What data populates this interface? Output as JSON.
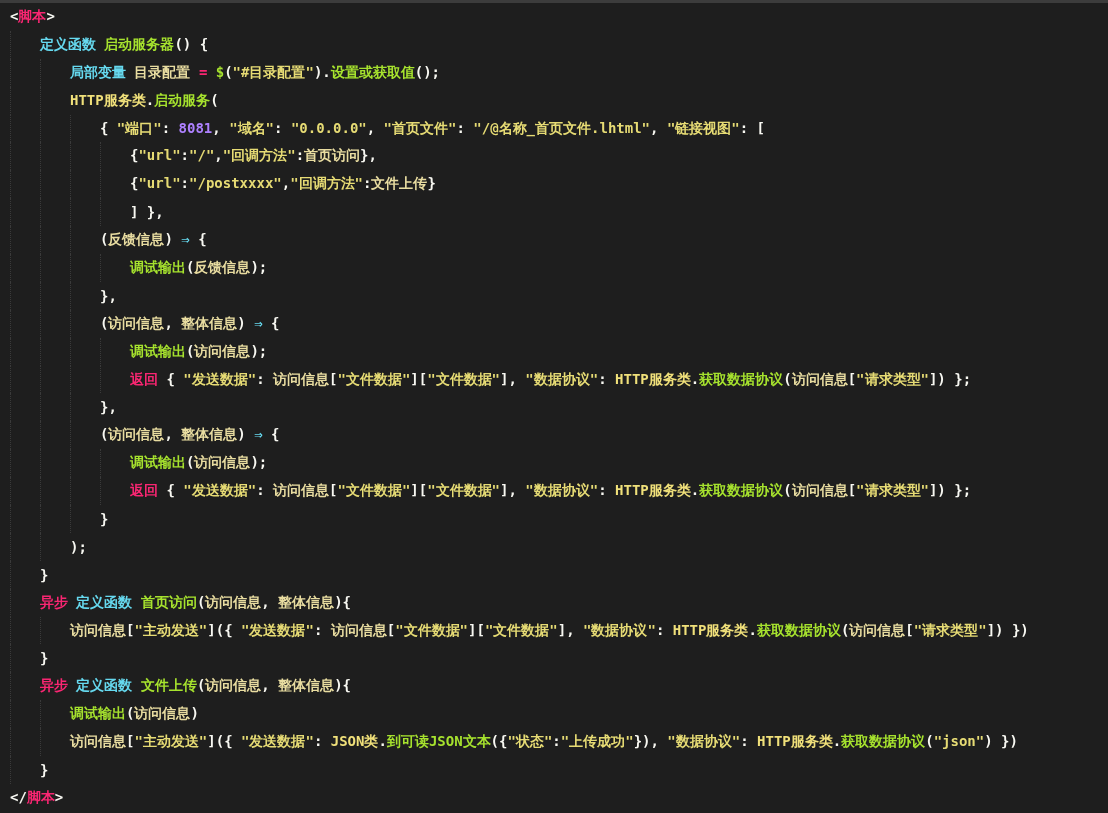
{
  "editor": {
    "lines": [
      {
        "tokens": [
          {
            "kind": "punct",
            "text": "<"
          },
          {
            "kind": "tag",
            "text": "脚本"
          },
          {
            "kind": "punct",
            "text": ">"
          }
        ],
        "children": [
          {
            "tokens": [
              {
                "kind": "kw",
                "text": "定义函数 "
              },
              {
                "kind": "fn",
                "text": "启动服务器"
              },
              {
                "kind": "punct",
                "text": "() {"
              }
            ],
            "children": [
              {
                "tokens": [
                  {
                    "kind": "kw",
                    "text": "局部变量 "
                  },
                  {
                    "kind": "id",
                    "text": "目录配置 "
                  },
                  {
                    "kind": "op",
                    "text": "= "
                  },
                  {
                    "kind": "fn",
                    "text": "$"
                  },
                  {
                    "kind": "punct",
                    "text": "("
                  },
                  {
                    "kind": "str",
                    "text": "\"#目录配置\""
                  },
                  {
                    "kind": "punct",
                    "text": ")."
                  },
                  {
                    "kind": "fn",
                    "text": "设置或获取值"
                  },
                  {
                    "kind": "punct",
                    "text": "();"
                  }
                ]
              },
              {
                "tokens": [
                  {
                    "kind": "cls",
                    "text": "HTTP服务类"
                  },
                  {
                    "kind": "punct",
                    "text": "."
                  },
                  {
                    "kind": "fn",
                    "text": "启动服务"
                  },
                  {
                    "kind": "punct",
                    "text": "("
                  }
                ],
                "children": [
                  {
                    "tokens": [
                      {
                        "kind": "punct",
                        "text": "{ "
                      },
                      {
                        "kind": "str",
                        "text": "\"端口\""
                      },
                      {
                        "kind": "punct",
                        "text": ": "
                      },
                      {
                        "kind": "num",
                        "text": "8081"
                      },
                      {
                        "kind": "punct",
                        "text": ", "
                      },
                      {
                        "kind": "str",
                        "text": "\"域名\""
                      },
                      {
                        "kind": "punct",
                        "text": ": "
                      },
                      {
                        "kind": "str",
                        "text": "\"0.0.0.0\""
                      },
                      {
                        "kind": "punct",
                        "text": ", "
                      },
                      {
                        "kind": "str",
                        "text": "\"首页文件\""
                      },
                      {
                        "kind": "punct",
                        "text": ": "
                      },
                      {
                        "kind": "str",
                        "text": "\"/@名称_首页文件.lhtml\""
                      },
                      {
                        "kind": "punct",
                        "text": ", "
                      },
                      {
                        "kind": "str",
                        "text": "\"链接视图\""
                      },
                      {
                        "kind": "punct",
                        "text": ": ["
                      }
                    ],
                    "children": [
                      {
                        "tokens": [
                          {
                            "kind": "punct",
                            "text": "{"
                          },
                          {
                            "kind": "str",
                            "text": "\"url\""
                          },
                          {
                            "kind": "punct",
                            "text": ":"
                          },
                          {
                            "kind": "str",
                            "text": "\"/\""
                          },
                          {
                            "kind": "punct",
                            "text": ","
                          },
                          {
                            "kind": "str",
                            "text": "\"回调方法\""
                          },
                          {
                            "kind": "punct",
                            "text": ":"
                          },
                          {
                            "kind": "id",
                            "text": "首页访问"
                          },
                          {
                            "kind": "punct",
                            "text": "},"
                          }
                        ]
                      },
                      {
                        "tokens": [
                          {
                            "kind": "punct",
                            "text": "{"
                          },
                          {
                            "kind": "str",
                            "text": "\"url\""
                          },
                          {
                            "kind": "punct",
                            "text": ":"
                          },
                          {
                            "kind": "str",
                            "text": "\"/postxxxx\""
                          },
                          {
                            "kind": "punct",
                            "text": ","
                          },
                          {
                            "kind": "str",
                            "text": "\"回调方法\""
                          },
                          {
                            "kind": "punct",
                            "text": ":"
                          },
                          {
                            "kind": "id",
                            "text": "文件上传"
                          },
                          {
                            "kind": "punct",
                            "text": "}"
                          }
                        ]
                      },
                      {
                        "tokens": [
                          {
                            "kind": "punct",
                            "text": "] },"
                          }
                        ]
                      }
                    ]
                  },
                  {
                    "tokens": [
                      {
                        "kind": "punct",
                        "text": "("
                      },
                      {
                        "kind": "id",
                        "text": "反馈信息"
                      },
                      {
                        "kind": "punct",
                        "text": ") "
                      },
                      {
                        "kind": "arrow",
                        "text": "⇒"
                      },
                      {
                        "kind": "punct",
                        "text": " {"
                      }
                    ],
                    "children": [
                      {
                        "tokens": [
                          {
                            "kind": "fn",
                            "text": "调试输出"
                          },
                          {
                            "kind": "punct",
                            "text": "("
                          },
                          {
                            "kind": "id",
                            "text": "反馈信息"
                          },
                          {
                            "kind": "punct",
                            "text": ");"
                          }
                        ]
                      }
                    ]
                  },
                  {
                    "tokens": [
                      {
                        "kind": "punct",
                        "text": "},"
                      }
                    ]
                  },
                  {
                    "tokens": [
                      {
                        "kind": "punct",
                        "text": "("
                      },
                      {
                        "kind": "id",
                        "text": "访问信息"
                      },
                      {
                        "kind": "punct",
                        "text": ", "
                      },
                      {
                        "kind": "id",
                        "text": "整体信息"
                      },
                      {
                        "kind": "punct",
                        "text": ") "
                      },
                      {
                        "kind": "arrow",
                        "text": "⇒"
                      },
                      {
                        "kind": "punct",
                        "text": " {"
                      }
                    ],
                    "children": [
                      {
                        "tokens": [
                          {
                            "kind": "fn",
                            "text": "调试输出"
                          },
                          {
                            "kind": "punct",
                            "text": "("
                          },
                          {
                            "kind": "id",
                            "text": "访问信息"
                          },
                          {
                            "kind": "punct",
                            "text": ");"
                          }
                        ]
                      },
                      {
                        "tokens": [
                          {
                            "kind": "tag",
                            "text": "返回"
                          },
                          {
                            "kind": "punct",
                            "text": " { "
                          },
                          {
                            "kind": "str",
                            "text": "\"发送数据\""
                          },
                          {
                            "kind": "punct",
                            "text": ": "
                          },
                          {
                            "kind": "id",
                            "text": "访问信息"
                          },
                          {
                            "kind": "punct",
                            "text": "["
                          },
                          {
                            "kind": "str",
                            "text": "\"文件数据\""
                          },
                          {
                            "kind": "punct",
                            "text": "]["
                          },
                          {
                            "kind": "str",
                            "text": "\"文件数据\""
                          },
                          {
                            "kind": "punct",
                            "text": "], "
                          },
                          {
                            "kind": "str",
                            "text": "\"数据协议\""
                          },
                          {
                            "kind": "punct",
                            "text": ": "
                          },
                          {
                            "kind": "cls",
                            "text": "HTTP服务类"
                          },
                          {
                            "kind": "punct",
                            "text": "."
                          },
                          {
                            "kind": "fn",
                            "text": "获取数据协议"
                          },
                          {
                            "kind": "punct",
                            "text": "("
                          },
                          {
                            "kind": "id",
                            "text": "访问信息"
                          },
                          {
                            "kind": "punct",
                            "text": "["
                          },
                          {
                            "kind": "str",
                            "text": "\"请求类型\""
                          },
                          {
                            "kind": "punct",
                            "text": "]) };"
                          }
                        ]
                      }
                    ]
                  },
                  {
                    "tokens": [
                      {
                        "kind": "punct",
                        "text": "},"
                      }
                    ]
                  },
                  {
                    "tokens": [
                      {
                        "kind": "punct",
                        "text": "("
                      },
                      {
                        "kind": "id",
                        "text": "访问信息"
                      },
                      {
                        "kind": "punct",
                        "text": ", "
                      },
                      {
                        "kind": "id",
                        "text": "整体信息"
                      },
                      {
                        "kind": "punct",
                        "text": ") "
                      },
                      {
                        "kind": "arrow",
                        "text": "⇒"
                      },
                      {
                        "kind": "punct",
                        "text": " {"
                      }
                    ],
                    "children": [
                      {
                        "tokens": [
                          {
                            "kind": "fn",
                            "text": "调试输出"
                          },
                          {
                            "kind": "punct",
                            "text": "("
                          },
                          {
                            "kind": "id",
                            "text": "访问信息"
                          },
                          {
                            "kind": "punct",
                            "text": ");"
                          }
                        ]
                      },
                      {
                        "tokens": [
                          {
                            "kind": "tag",
                            "text": "返回"
                          },
                          {
                            "kind": "punct",
                            "text": " { "
                          },
                          {
                            "kind": "str",
                            "text": "\"发送数据\""
                          },
                          {
                            "kind": "punct",
                            "text": ": "
                          },
                          {
                            "kind": "id",
                            "text": "访问信息"
                          },
                          {
                            "kind": "punct",
                            "text": "["
                          },
                          {
                            "kind": "str",
                            "text": "\"文件数据\""
                          },
                          {
                            "kind": "punct",
                            "text": "]["
                          },
                          {
                            "kind": "str",
                            "text": "\"文件数据\""
                          },
                          {
                            "kind": "punct",
                            "text": "], "
                          },
                          {
                            "kind": "str",
                            "text": "\"数据协议\""
                          },
                          {
                            "kind": "punct",
                            "text": ": "
                          },
                          {
                            "kind": "cls",
                            "text": "HTTP服务类"
                          },
                          {
                            "kind": "punct",
                            "text": "."
                          },
                          {
                            "kind": "fn",
                            "text": "获取数据协议"
                          },
                          {
                            "kind": "punct",
                            "text": "("
                          },
                          {
                            "kind": "id",
                            "text": "访问信息"
                          },
                          {
                            "kind": "punct",
                            "text": "["
                          },
                          {
                            "kind": "str",
                            "text": "\"请求类型\""
                          },
                          {
                            "kind": "punct",
                            "text": "]) };"
                          }
                        ]
                      }
                    ]
                  },
                  {
                    "tokens": [
                      {
                        "kind": "punct",
                        "text": "}"
                      }
                    ]
                  }
                ]
              },
              {
                "tokens": [
                  {
                    "kind": "punct",
                    "text": ");"
                  }
                ]
              }
            ]
          },
          {
            "tokens": [
              {
                "kind": "punct",
                "text": "}"
              }
            ]
          },
          {
            "tokens": [
              {
                "kind": "tag",
                "text": "异步 "
              },
              {
                "kind": "kw",
                "text": "定义函数 "
              },
              {
                "kind": "fn",
                "text": "首页访问"
              },
              {
                "kind": "punct",
                "text": "("
              },
              {
                "kind": "id",
                "text": "访问信息"
              },
              {
                "kind": "punct",
                "text": ", "
              },
              {
                "kind": "id",
                "text": "整体信息"
              },
              {
                "kind": "punct",
                "text": "){"
              }
            ],
            "children": [
              {
                "tokens": [
                  {
                    "kind": "id",
                    "text": "访问信息"
                  },
                  {
                    "kind": "punct",
                    "text": "["
                  },
                  {
                    "kind": "str",
                    "text": "\"主动发送\""
                  },
                  {
                    "kind": "punct",
                    "text": "]({ "
                  },
                  {
                    "kind": "str",
                    "text": "\"发送数据\""
                  },
                  {
                    "kind": "punct",
                    "text": ": "
                  },
                  {
                    "kind": "id",
                    "text": "访问信息"
                  },
                  {
                    "kind": "punct",
                    "text": "["
                  },
                  {
                    "kind": "str",
                    "text": "\"文件数据\""
                  },
                  {
                    "kind": "punct",
                    "text": "]["
                  },
                  {
                    "kind": "str",
                    "text": "\"文件数据\""
                  },
                  {
                    "kind": "punct",
                    "text": "], "
                  },
                  {
                    "kind": "str",
                    "text": "\"数据协议\""
                  },
                  {
                    "kind": "punct",
                    "text": ": "
                  },
                  {
                    "kind": "cls",
                    "text": "HTTP服务类"
                  },
                  {
                    "kind": "punct",
                    "text": "."
                  },
                  {
                    "kind": "fn",
                    "text": "获取数据协议"
                  },
                  {
                    "kind": "punct",
                    "text": "("
                  },
                  {
                    "kind": "id",
                    "text": "访问信息"
                  },
                  {
                    "kind": "punct",
                    "text": "["
                  },
                  {
                    "kind": "str",
                    "text": "\"请求类型\""
                  },
                  {
                    "kind": "punct",
                    "text": "]) })"
                  }
                ]
              }
            ]
          },
          {
            "tokens": [
              {
                "kind": "punct",
                "text": "}"
              }
            ]
          },
          {
            "tokens": [
              {
                "kind": "tag",
                "text": "异步 "
              },
              {
                "kind": "kw",
                "text": "定义函数 "
              },
              {
                "kind": "fn",
                "text": "文件上传"
              },
              {
                "kind": "punct",
                "text": "("
              },
              {
                "kind": "id",
                "text": "访问信息"
              },
              {
                "kind": "punct",
                "text": ", "
              },
              {
                "kind": "id",
                "text": "整体信息"
              },
              {
                "kind": "punct",
                "text": "){"
              }
            ],
            "children": [
              {
                "tokens": [
                  {
                    "kind": "fn",
                    "text": "调试输出"
                  },
                  {
                    "kind": "punct",
                    "text": "("
                  },
                  {
                    "kind": "id",
                    "text": "访问信息"
                  },
                  {
                    "kind": "punct",
                    "text": ")"
                  }
                ]
              },
              {
                "tokens": [
                  {
                    "kind": "id",
                    "text": "访问信息"
                  },
                  {
                    "kind": "punct",
                    "text": "["
                  },
                  {
                    "kind": "str",
                    "text": "\"主动发送\""
                  },
                  {
                    "kind": "punct",
                    "text": "]({ "
                  },
                  {
                    "kind": "str",
                    "text": "\"发送数据\""
                  },
                  {
                    "kind": "punct",
                    "text": ": "
                  },
                  {
                    "kind": "cls",
                    "text": "JSON类"
                  },
                  {
                    "kind": "punct",
                    "text": "."
                  },
                  {
                    "kind": "fn",
                    "text": "到可读JSON文本"
                  },
                  {
                    "kind": "punct",
                    "text": "({"
                  },
                  {
                    "kind": "str",
                    "text": "\"状态\""
                  },
                  {
                    "kind": "punct",
                    "text": ":"
                  },
                  {
                    "kind": "str",
                    "text": "\"上传成功\""
                  },
                  {
                    "kind": "punct",
                    "text": "}), "
                  },
                  {
                    "kind": "str",
                    "text": "\"数据协议\""
                  },
                  {
                    "kind": "punct",
                    "text": ": "
                  },
                  {
                    "kind": "cls",
                    "text": "HTTP服务类"
                  },
                  {
                    "kind": "punct",
                    "text": "."
                  },
                  {
                    "kind": "fn",
                    "text": "获取数据协议"
                  },
                  {
                    "kind": "punct",
                    "text": "("
                  },
                  {
                    "kind": "str",
                    "text": "\"json\""
                  },
                  {
                    "kind": "punct",
                    "text": ") })"
                  }
                ]
              }
            ]
          },
          {
            "tokens": [
              {
                "kind": "punct",
                "text": "}"
              }
            ]
          }
        ]
      },
      {
        "tokens": [
          {
            "kind": "punct",
            "text": "</"
          },
          {
            "kind": "tag",
            "text": "脚本"
          },
          {
            "kind": "punct",
            "text": ">"
          }
        ]
      }
    ]
  }
}
